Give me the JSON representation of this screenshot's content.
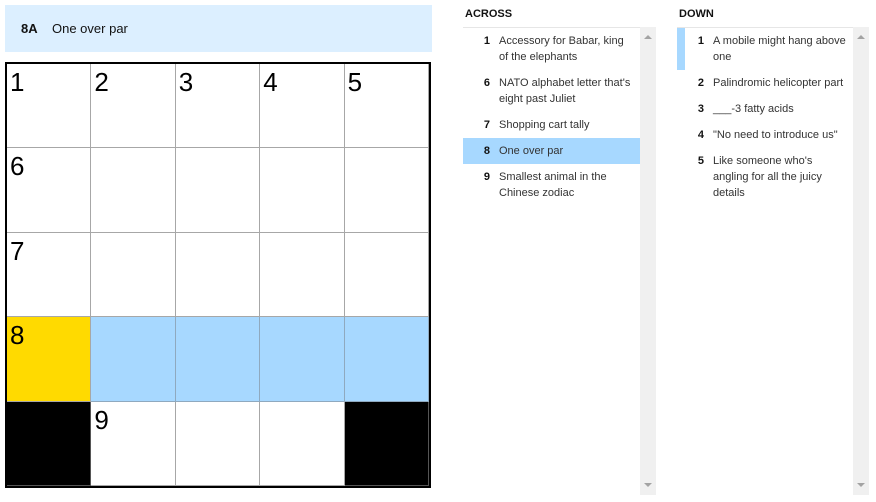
{
  "clue_bar": {
    "number": "8A",
    "text": "One over par"
  },
  "grid": {
    "rows": [
      [
        {
          "n": "1",
          "s": "white"
        },
        {
          "n": "2",
          "s": "white"
        },
        {
          "n": "3",
          "s": "white"
        },
        {
          "n": "4",
          "s": "white"
        },
        {
          "n": "5",
          "s": "white"
        }
      ],
      [
        {
          "n": "6",
          "s": "white"
        },
        {
          "n": "",
          "s": "white"
        },
        {
          "n": "",
          "s": "white"
        },
        {
          "n": "",
          "s": "white"
        },
        {
          "n": "",
          "s": "white"
        }
      ],
      [
        {
          "n": "7",
          "s": "white"
        },
        {
          "n": "",
          "s": "white"
        },
        {
          "n": "",
          "s": "white"
        },
        {
          "n": "",
          "s": "white"
        },
        {
          "n": "",
          "s": "white"
        }
      ],
      [
        {
          "n": "8",
          "s": "selected"
        },
        {
          "n": "",
          "s": "highlighted"
        },
        {
          "n": "",
          "s": "highlighted"
        },
        {
          "n": "",
          "s": "highlighted"
        },
        {
          "n": "",
          "s": "highlighted"
        }
      ],
      [
        {
          "n": "",
          "s": "black"
        },
        {
          "n": "9",
          "s": "white"
        },
        {
          "n": "",
          "s": "white"
        },
        {
          "n": "",
          "s": "white"
        },
        {
          "n": "",
          "s": "black"
        }
      ]
    ]
  },
  "across": {
    "title": "ACROSS",
    "clues": [
      {
        "n": "1",
        "text": "Accessory for Babar, king of the elephants",
        "state": ""
      },
      {
        "n": "6",
        "text": "NATO alphabet letter that's eight past Juliet",
        "state": ""
      },
      {
        "n": "7",
        "text": "Shopping cart tally",
        "state": ""
      },
      {
        "n": "8",
        "text": "One over par",
        "state": "active"
      },
      {
        "n": "9",
        "text": "Smallest animal in the Chinese zodiac",
        "state": ""
      }
    ]
  },
  "down": {
    "title": "DOWN",
    "clues": [
      {
        "n": "1",
        "text": "A mobile might hang above one",
        "state": "cross"
      },
      {
        "n": "2",
        "text": "Palindromic helicopter part",
        "state": ""
      },
      {
        "n": "3",
        "text": "___-3 fatty acids",
        "state": ""
      },
      {
        "n": "4",
        "text": "\"No need to introduce us\"",
        "state": ""
      },
      {
        "n": "5",
        "text": "Like someone who's angling for all the juicy details",
        "state": ""
      }
    ]
  },
  "colors": {
    "selected": "#ffda00",
    "highlighted": "#a7d8ff",
    "clue_bar": "#dcefff"
  }
}
